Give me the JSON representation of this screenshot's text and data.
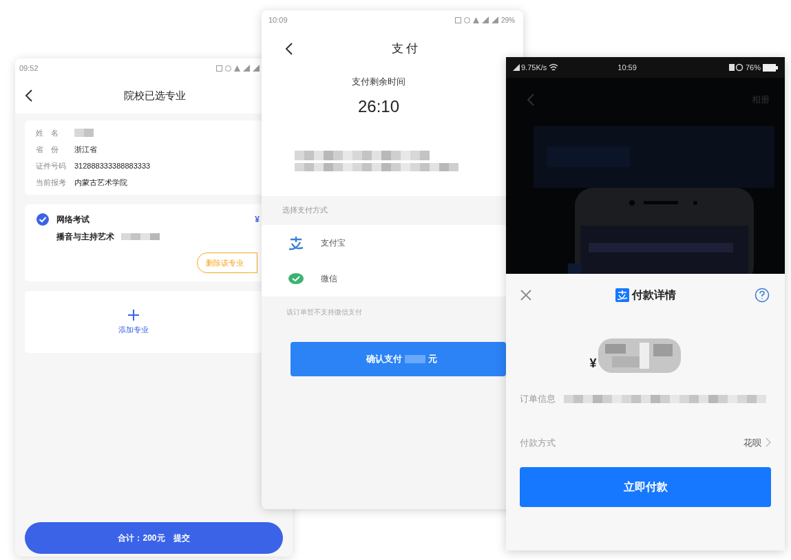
{
  "screens": [
    {
      "kind": "major_list",
      "time": "09:52",
      "title": "院校已选专业",
      "info": [
        {
          "label": "姓　名",
          "blurred": true
        },
        {
          "label": "省　份",
          "value": "浙江省",
          "blurred": false
        },
        {
          "label": "证件号码",
          "value": "312888333388883333",
          "blurred": false
        },
        {
          "label": "当前报考",
          "value": "内蒙古艺术学院",
          "blurred": false
        }
      ],
      "major": {
        "checked": true,
        "exam": "网络考试",
        "price": "¥",
        "name": "播音与主持艺术",
        "delete_button": "删除该专业"
      },
      "add_label": "添加专业",
      "total": "合计：200元",
      "submit": "提交"
    },
    {
      "kind": "payment",
      "time": "10:09",
      "battery": "29%",
      "title": "支付",
      "countdown_label": "支付剩余时间",
      "countdown": "26:10",
      "section_label": "选择支付方式",
      "methods": [
        {
          "kind": "alipay",
          "label": "支付宝"
        },
        {
          "kind": "wechat",
          "label": "微信"
        }
      ],
      "note": "该订单暂不支持微信支付",
      "confirm": "确认支付",
      "currency_unit": "元"
    },
    {
      "kind": "alipay_sheet",
      "speed": "9.75K/s",
      "time": "10:59",
      "battery": "76%",
      "album": "相册",
      "title": "付款详情",
      "currency": "¥",
      "order_label": "订单信息",
      "method_label": "付款方式",
      "method_value": "花呗",
      "pay_button": "立即付款"
    }
  ]
}
